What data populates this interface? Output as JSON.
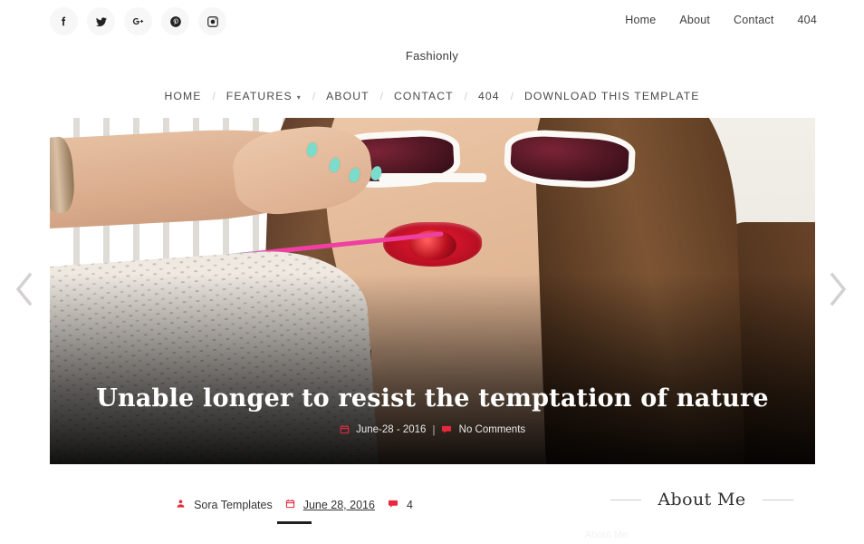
{
  "topbar": {
    "social": [
      {
        "name": "facebook-icon",
        "label": "Facebook"
      },
      {
        "name": "twitter-icon",
        "label": "Twitter"
      },
      {
        "name": "googleplus-icon",
        "label": "Google Plus"
      },
      {
        "name": "pinterest-icon",
        "label": "Pinterest"
      },
      {
        "name": "instagram-icon",
        "label": "Instagram"
      }
    ],
    "nav": [
      {
        "label": "Home"
      },
      {
        "label": "About"
      },
      {
        "label": "Contact"
      },
      {
        "label": "404"
      }
    ]
  },
  "site": {
    "title": "Fashionly"
  },
  "mainnav": {
    "separator": "/",
    "items": [
      {
        "label": "HOME",
        "has_caret": false
      },
      {
        "label": "FEATURES",
        "has_caret": true
      },
      {
        "label": "ABOUT",
        "has_caret": false
      },
      {
        "label": "CONTACT",
        "has_caret": false
      },
      {
        "label": "404",
        "has_caret": false
      },
      {
        "label": "DOWNLOAD THIS TEMPLATE",
        "has_caret": false
      }
    ]
  },
  "slider": {
    "headline": "Unable longer to resist the temptation of nature",
    "date": "June-28 - 2016",
    "divider": "|",
    "comments": "No Comments",
    "prev_arrow": "‹",
    "next_arrow": "›"
  },
  "post": {
    "author": "Sora Templates",
    "date": "June 28, 2016",
    "comment_count": "4"
  },
  "sidebar": {
    "widget_title": "About Me",
    "widget_sub": "About Me"
  },
  "colors": {
    "accent_red": "#e8283c",
    "text_dark": "#333333",
    "nav_text": "#4a4a4a",
    "arrow_gray": "#d2d0d0",
    "nail_mint": "#7adccb"
  }
}
